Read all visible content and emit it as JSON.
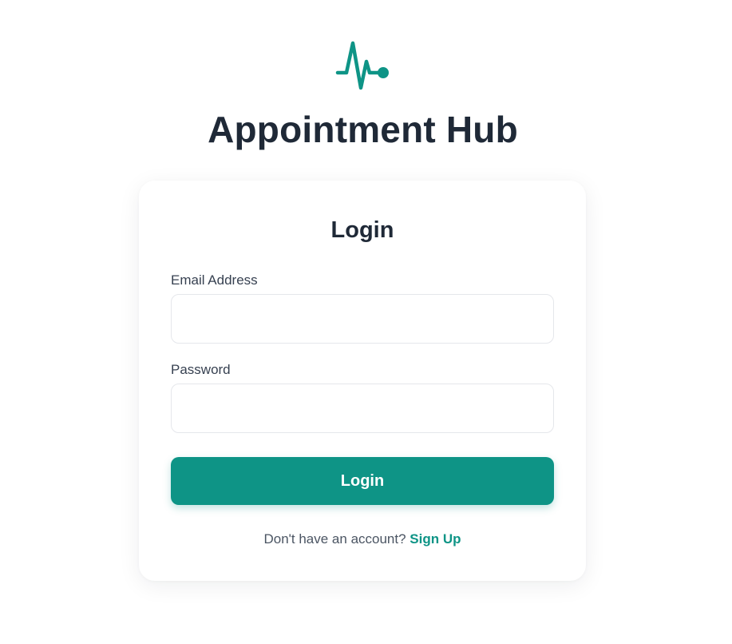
{
  "brand": {
    "logo_icon": "heartbeat-pulse-icon",
    "title": "Appointment Hub",
    "accent_color": "#0e9486"
  },
  "login_card": {
    "heading": "Login",
    "email": {
      "label": "Email Address",
      "value": "",
      "placeholder": ""
    },
    "password": {
      "label": "Password",
      "value": "",
      "placeholder": ""
    },
    "submit_label": "Login",
    "signup_prompt": "Don't have an account?",
    "signup_link": "Sign Up"
  },
  "colors": {
    "text_dark": "#1f2937",
    "text_muted": "#4b5563",
    "input_border": "#e5e7eb",
    "background": "#ffffff"
  }
}
